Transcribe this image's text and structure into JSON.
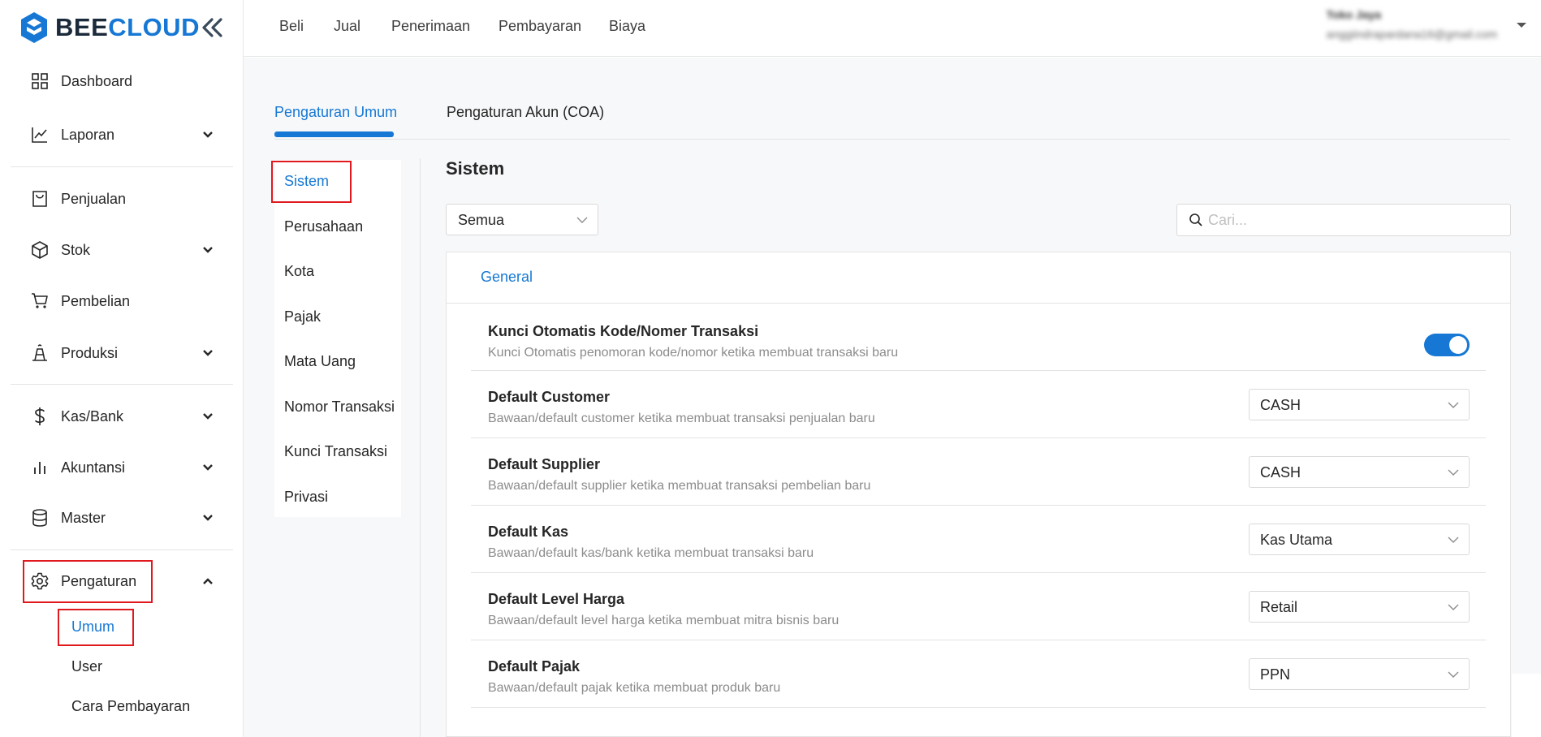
{
  "brand": {
    "part1": "BEE",
    "part2": "CLOUD",
    "accent": "#1678d4",
    "dark": "#1b2a3a"
  },
  "sidebar": {
    "items": [
      {
        "label": "Dashboard",
        "icon": "grid-icon"
      },
      {
        "label": "Laporan",
        "icon": "chart-line-icon"
      },
      {
        "label": "Penjualan",
        "icon": "receipt-icon"
      },
      {
        "label": "Stok",
        "icon": "box-icon"
      },
      {
        "label": "Pembelian",
        "icon": "cart-icon"
      },
      {
        "label": "Produksi",
        "icon": "factory-icon"
      },
      {
        "label": "Kas/Bank",
        "icon": "dollar-icon"
      },
      {
        "label": "Akuntansi",
        "icon": "bar-chart-icon"
      },
      {
        "label": "Master",
        "icon": "database-icon"
      },
      {
        "label": "Pengaturan",
        "icon": "gear-icon"
      }
    ],
    "sub_items": [
      "Umum",
      "User",
      "Cara Pembayaran"
    ]
  },
  "topnav": {
    "items": [
      "Beli",
      "Jual",
      "Penerimaan",
      "Pembayaran",
      "Biaya"
    ],
    "user_name": "Toko Jaya",
    "user_email": "anggiindrapardana16@gmail.com"
  },
  "tabs": [
    "Pengaturan Umum",
    "Pengaturan Akun (COA)"
  ],
  "subnav": [
    "Sistem",
    "Perusahaan",
    "Kota",
    "Pajak",
    "Mata Uang",
    "Nomor Transaksi",
    "Kunci Transaksi",
    "Privasi"
  ],
  "section": {
    "title": "Sistem",
    "filter_value": "Semua",
    "search_placeholder": "Cari...",
    "card_tab": "General"
  },
  "settings": [
    {
      "title": "Kunci Otomatis Kode/Nomer Transaksi",
      "desc": "Kunci Otomatis penomoran kode/nomor ketika membuat transaksi baru",
      "control": "toggle",
      "enabled": true
    },
    {
      "title": "Default Customer",
      "desc": "Bawaan/default customer ketika membuat transaksi penjualan baru",
      "control": "select",
      "value": "CASH"
    },
    {
      "title": "Default Supplier",
      "desc": "Bawaan/default supplier ketika membuat transaksi pembelian baru",
      "control": "select",
      "value": "CASH"
    },
    {
      "title": "Default Kas",
      "desc": "Bawaan/default kas/bank ketika membuat transaksi baru",
      "control": "select",
      "value": "Kas Utama"
    },
    {
      "title": "Default Level Harga",
      "desc": "Bawaan/default level harga ketika membuat mitra bisnis baru",
      "control": "select",
      "value": "Retail"
    },
    {
      "title": "Default Pajak",
      "desc": "Bawaan/default pajak ketika membuat produk baru",
      "control": "select",
      "value": "PPN"
    }
  ]
}
